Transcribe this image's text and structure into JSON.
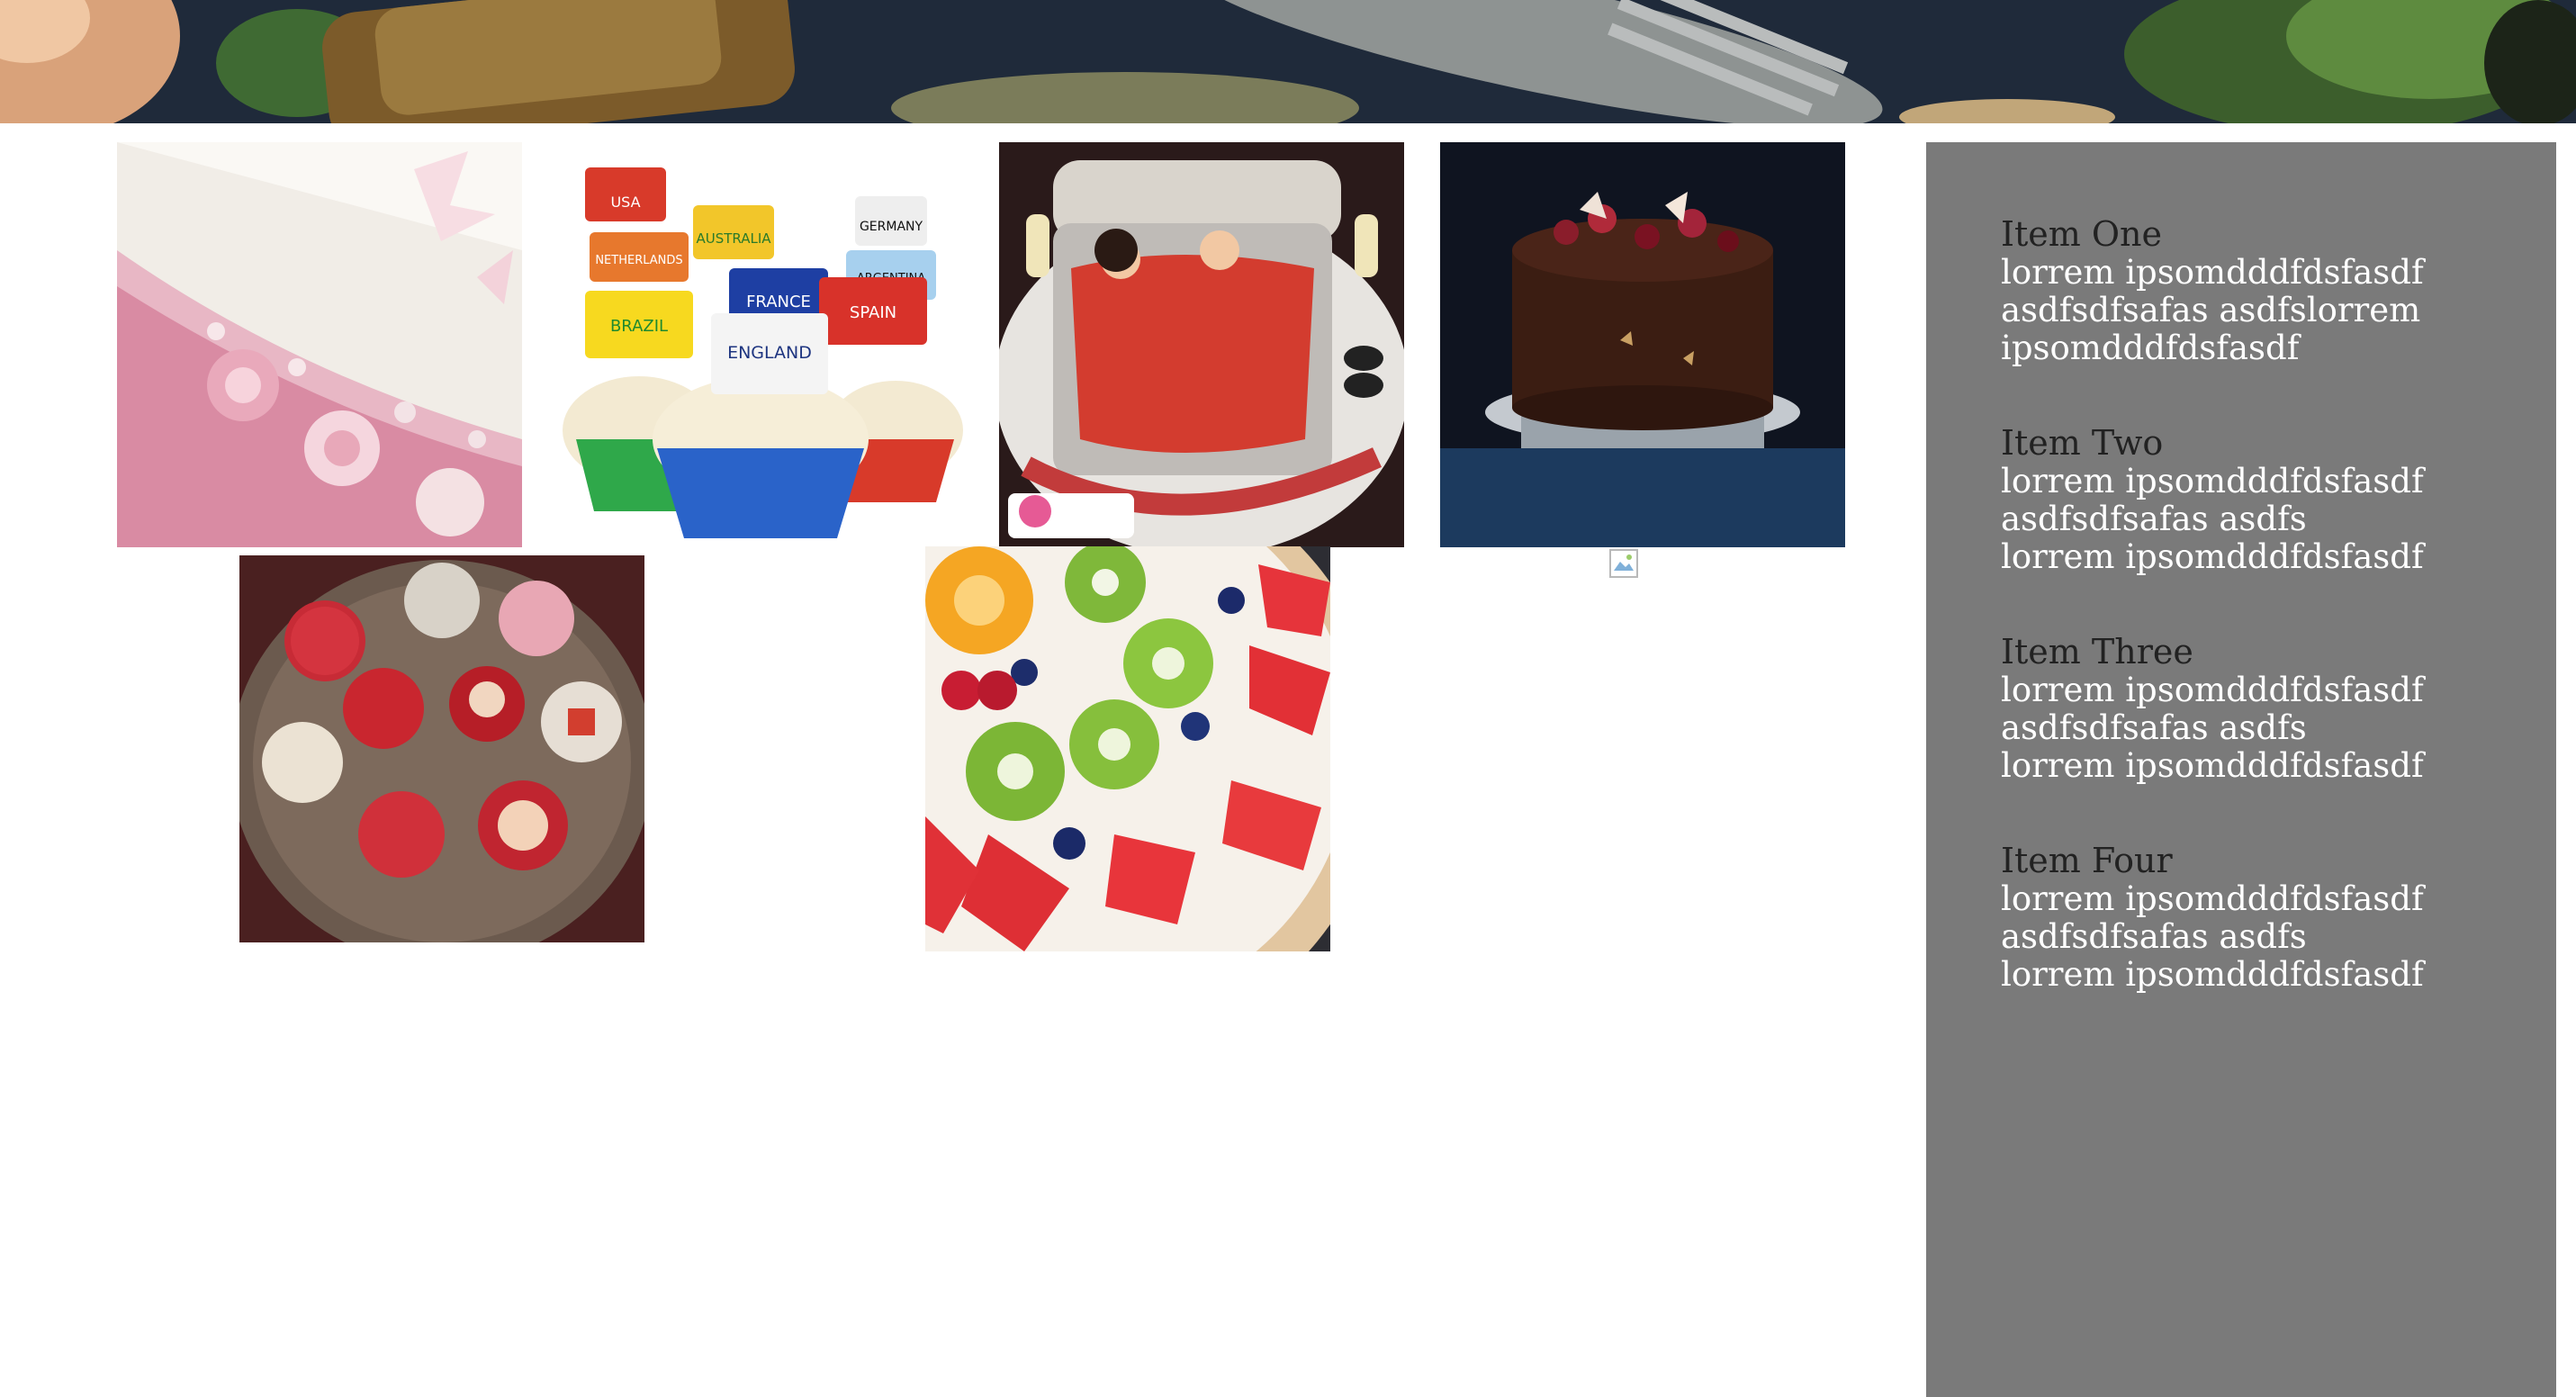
{
  "banner": {
    "alt": "food photo banner"
  },
  "gallery": [
    {
      "name": "pink flower cake"
    },
    {
      "name": "world cup cupcakes",
      "flags": [
        "USA",
        "AUSTRALIA",
        "GERMANY",
        "NETHERLANDS",
        "ARGENTINA",
        "FRANCE",
        "BRAZIL",
        "SPAIN",
        "ENGLAND"
      ]
    },
    {
      "name": "bed cake"
    },
    {
      "name": "chocolate cake"
    },
    {
      "name": "decorated cupcakes plate"
    },
    {
      "name": "fruit pizza"
    }
  ],
  "sidebar": {
    "items": [
      {
        "title": "Item One",
        "text": "lorrem ipsomdddfdsfasdf asdfsdfsafas asdfslorrem ipsomdddfdsfasdf"
      },
      {
        "title": "Item Two",
        "text": "lorrem ipsomdddfdsfasdf asdfsdfsafas asdfs lorrem ipsomdddfdsfasdf"
      },
      {
        "title": "Item Three",
        "text": "lorrem ipsomdddfdsfasdf asdfsdfsafas asdfs lorrem ipsomdddfdsfasdf"
      },
      {
        "title": "Item Four",
        "text": "lorrem ipsomdddfdsfasdf asdfsdfsafas asdfs lorrem ipsomdddfdsfasdf"
      }
    ]
  },
  "colors": {
    "sidebar_bg": "#7a7a7a",
    "sidebar_title": "#222222",
    "sidebar_text": "#ffffff"
  }
}
